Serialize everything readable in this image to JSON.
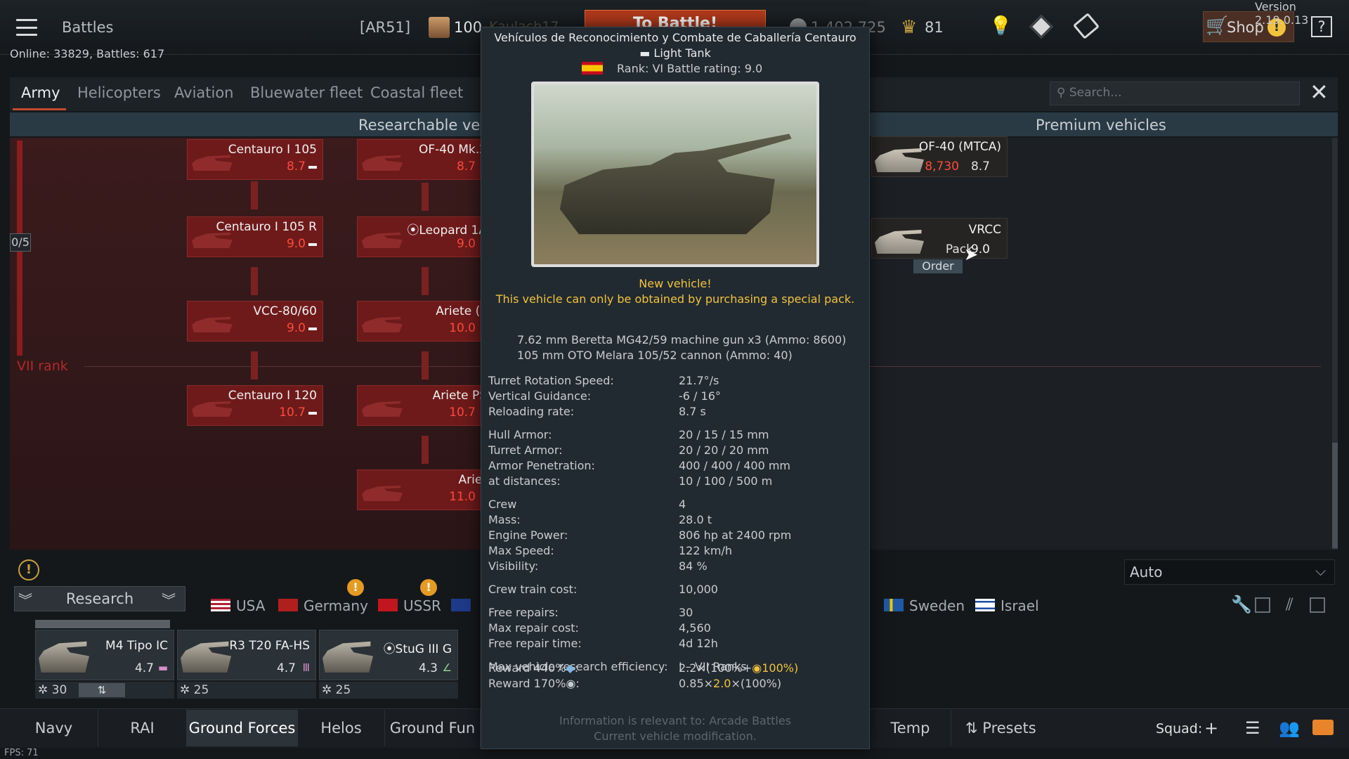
{
  "topbar": {
    "battles_label": "Battles",
    "squadron_tag": "[AR51]",
    "player_level": "100",
    "player_name": "Kaulach17",
    "to_battle": "To Battle!",
    "silver": "1,402,725",
    "gold": "81",
    "shop_label": "Shop",
    "shop_alert": "!",
    "help": "?",
    "version": "Version 2.19.0.13",
    "online": "Online: 33829, Battles: 617"
  },
  "tabs": [
    "Army",
    "Helicopters",
    "Aviation",
    "Bluewater fleet",
    "Coastal fleet"
  ],
  "search": {
    "placeholder": "Search..."
  },
  "tree": {
    "researchable_label": "Researchable vehic",
    "premium_label": "Premium vehicles",
    "rank_counter": "0/5",
    "rank_label": "VII rank",
    "column1": [
      {
        "name": "Centauro I 105",
        "br": "8.7"
      },
      {
        "name": "Centauro I 105 R",
        "br": "9.0"
      },
      {
        "name": "VCC-80/60",
        "br": "9.0"
      },
      {
        "name": "Centauro I 120",
        "br": "10.7"
      }
    ],
    "column2": [
      {
        "name": "OF-40 Mk.2",
        "br": "8.7"
      },
      {
        "name": "⦿Leopard 1A",
        "br": "9.0"
      },
      {
        "name": "Ariete (F",
        "br": "10.0"
      },
      {
        "name": "Ariete PS",
        "br": "10.7"
      },
      {
        "name": "Ariet",
        "br": "11.0"
      }
    ],
    "premium": [
      {
        "name": "OF-40 (MTCA)",
        "price": "8,730",
        "br": "8.7"
      },
      {
        "name": "VRCC",
        "price": "Pack",
        "br": "9.0"
      }
    ],
    "order_label": "Order"
  },
  "nations": {
    "research_btn": "Research",
    "list": [
      "USA",
      "Germany",
      "USSR",
      "Sweden",
      "Israel"
    ],
    "auto_label": "Auto"
  },
  "slots": [
    {
      "name": "M4 Tipo IC",
      "br": "4.7",
      "crew": "30"
    },
    {
      "name": "R3 T20 FA-HS",
      "br": "4.7",
      "crew": "25"
    },
    {
      "name": "⦿StuG III G",
      "br": "4.3",
      "crew": "25"
    }
  ],
  "bottom": {
    "tabs": [
      "Navy",
      "RAI",
      "Ground Forces",
      "Helos",
      "Ground Fun",
      "Temp"
    ],
    "presets": "Presets",
    "squad": "Squad:",
    "fps": "FPS: 71"
  },
  "tooltip": {
    "title": "Vehículos de Reconocimiento y Combate de Caballería Centauro",
    "class": "▬ Light Tank",
    "rank": "Rank: VI    Battle rating: 9.0",
    "new_vehicle": "New vehicle!",
    "pack_note": "This vehicle can only be obtained by purchasing a special pack.",
    "armament": [
      "7.62 mm Beretta MG42/59 machine gun x3 (Ammo: 8600)",
      "105 mm OTO Melara 105/52 cannon (Ammo: 40)"
    ],
    "stats": [
      {
        "k": "Turret Rotation Speed:",
        "v": "21.7°/s"
      },
      {
        "k": "Vertical Guidance:",
        "v": "-6 / 16°"
      },
      {
        "k": "Reloading rate:",
        "v": "8.7 s"
      },
      {
        "k": "Hull Armor:",
        "v": "20 / 15 / 15 mm"
      },
      {
        "k": "Turret Armor:",
        "v": "20 / 20 / 20 mm"
      },
      {
        "k": "Armor Penetration:",
        "v": "400 / 400 / 400 mm"
      },
      {
        "k": "at distances:",
        "v": "10 / 100 / 500 m"
      },
      {
        "k": "Crew",
        "v": "4"
      },
      {
        "k": "Mass:",
        "v": "28.0 t"
      },
      {
        "k": "Engine Power:",
        "v": "806 hp at 2400 rpm"
      },
      {
        "k": "Max Speed:",
        "v": "122 km/h"
      },
      {
        "k": "Visibility:",
        "v": "84 %"
      },
      {
        "k": "Crew train cost:",
        "v": "10,000"
      },
      {
        "k": "Free repairs:",
        "v": "30"
      },
      {
        "k": "Max repair cost:",
        "v": "4,560"
      },
      {
        "k": "Free repair time:",
        "v": "4d 12h"
      },
      {
        "k": "Max vehicle research efficiency:",
        "v": "I – VII Ranks"
      }
    ],
    "reward1_label": "Reward 440%",
    "reward1_value": "2.2×(100%+",
    "reward1_bonus": "100%)",
    "reward2_label": "Reward 170%",
    "reward2_value": "0.85×",
    "reward2_bonus": "2.0",
    "reward2_tail": "×(100%)",
    "info1": "Information is relevant to: Arcade Battles",
    "info2": "Current vehicle modification."
  }
}
